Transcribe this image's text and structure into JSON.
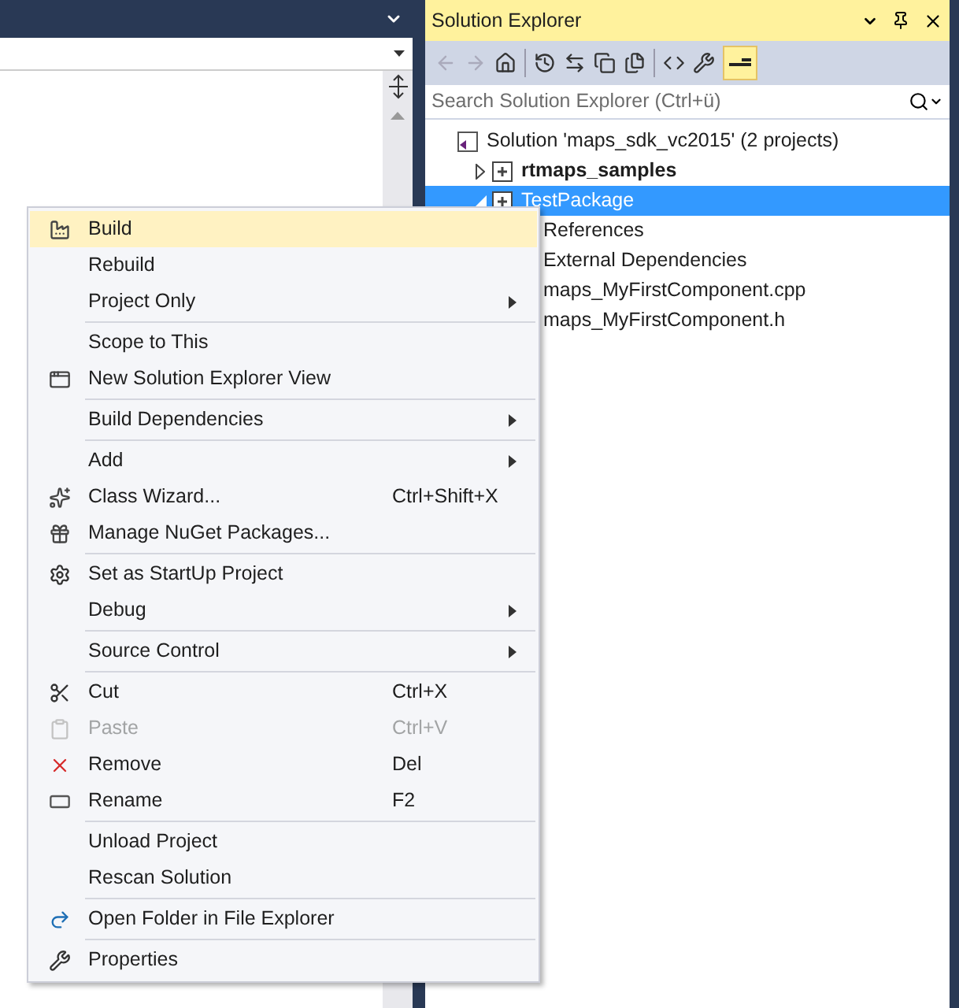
{
  "solution_explorer": {
    "title": "Solution Explorer",
    "search": {
      "placeholder": "Search Solution Explorer (Ctrl+ü)"
    },
    "tree": [
      {
        "label": "Solution 'maps_sdk_vc2015' (2 projects)",
        "bold": false,
        "selected": false,
        "children": [
          {
            "label": "rtmaps_samples",
            "bold": true,
            "selected": false,
            "expanded": false
          },
          {
            "label": "TestPackage",
            "bold": false,
            "selected": true,
            "expanded": true,
            "children": [
              {
                "label": "References",
                "bold": false,
                "selected": false
              },
              {
                "label": "External Dependencies",
                "bold": false,
                "selected": false
              },
              {
                "label": "maps_MyFirstComponent.cpp",
                "bold": false,
                "selected": false
              },
              {
                "label": "maps_MyFirstComponent.h",
                "bold": false,
                "selected": false
              }
            ]
          }
        ]
      }
    ]
  },
  "context_menu": {
    "items": [
      {
        "kind": "item",
        "label": "Build",
        "selected": true,
        "disabled": false,
        "submenu": false
      },
      {
        "kind": "item",
        "label": "Rebuild",
        "selected": false,
        "disabled": false,
        "submenu": false
      },
      {
        "kind": "item",
        "label": "Project Only",
        "selected": false,
        "disabled": false,
        "submenu": true
      },
      {
        "kind": "separator"
      },
      {
        "kind": "item",
        "label": "Scope to This",
        "selected": false,
        "disabled": false,
        "submenu": false
      },
      {
        "kind": "item",
        "label": "New Solution Explorer View",
        "selected": false,
        "disabled": false,
        "submenu": false
      },
      {
        "kind": "separator"
      },
      {
        "kind": "item",
        "label": "Build Dependencies",
        "selected": false,
        "disabled": false,
        "submenu": true
      },
      {
        "kind": "separator"
      },
      {
        "kind": "item",
        "label": "Add",
        "selected": false,
        "disabled": false,
        "submenu": true
      },
      {
        "kind": "item",
        "label": "Class Wizard...",
        "shortcut": "Ctrl+Shift+X",
        "selected": false,
        "disabled": false,
        "submenu": false
      },
      {
        "kind": "item",
        "label": "Manage NuGet Packages...",
        "selected": false,
        "disabled": false,
        "submenu": false
      },
      {
        "kind": "separator"
      },
      {
        "kind": "item",
        "label": "Set as StartUp Project",
        "selected": false,
        "disabled": false,
        "submenu": false
      },
      {
        "kind": "item",
        "label": "Debug",
        "selected": false,
        "disabled": false,
        "submenu": true
      },
      {
        "kind": "separator"
      },
      {
        "kind": "item",
        "label": "Source Control",
        "selected": false,
        "disabled": false,
        "submenu": true
      },
      {
        "kind": "separator"
      },
      {
        "kind": "item",
        "label": "Cut",
        "shortcut": "Ctrl+X",
        "selected": false,
        "disabled": false,
        "submenu": false
      },
      {
        "kind": "item",
        "label": "Paste",
        "shortcut": "Ctrl+V",
        "selected": false,
        "disabled": true,
        "submenu": false
      },
      {
        "kind": "item",
        "label": "Remove",
        "shortcut": "Del",
        "selected": false,
        "disabled": false,
        "submenu": false
      },
      {
        "kind": "item",
        "label": "Rename",
        "shortcut": "F2",
        "selected": false,
        "disabled": false,
        "submenu": false
      },
      {
        "kind": "separator"
      },
      {
        "kind": "item",
        "label": "Unload Project",
        "selected": false,
        "disabled": false,
        "submenu": false
      },
      {
        "kind": "item",
        "label": "Rescan Solution",
        "selected": false,
        "disabled": false,
        "submenu": false
      },
      {
        "kind": "separator"
      },
      {
        "kind": "item",
        "label": "Open Folder in File Explorer",
        "selected": false,
        "disabled": false,
        "submenu": false
      },
      {
        "kind": "separator"
      },
      {
        "kind": "item",
        "label": "Properties",
        "selected": false,
        "disabled": false,
        "submenu": false
      }
    ]
  }
}
